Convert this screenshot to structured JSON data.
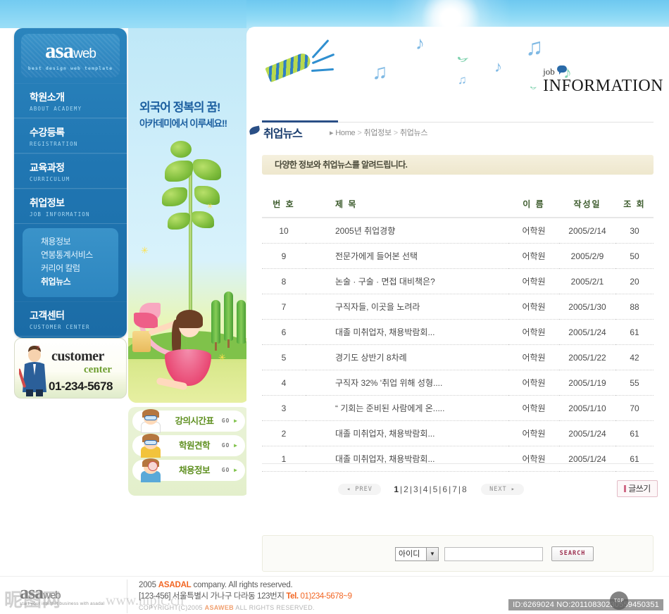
{
  "site": {
    "logo_main": "asa",
    "logo_web": "web",
    "logo_tagline": "best design web template"
  },
  "hero": {
    "line1": "외국어 정복의 꿈!",
    "line2": "아카데미에서 이루세요!!"
  },
  "sidebar": {
    "items": [
      {
        "ko": "학원소개",
        "en": "ABOUT ACADEMY"
      },
      {
        "ko": "수강등록",
        "en": "REGISTRATION"
      },
      {
        "ko": "교육과정",
        "en": "CURRICULUM"
      },
      {
        "ko": "취업정보",
        "en": "JOB INFORMATION"
      },
      {
        "ko": "고객센터",
        "en": "CUSTOMER CENTER"
      }
    ],
    "submenu": [
      {
        "label": "채용정보",
        "active": false
      },
      {
        "label": "연봉통계서비스",
        "active": false
      },
      {
        "label": "커리어 칼럼",
        "active": false
      },
      {
        "label": "취업뉴스",
        "active": true
      }
    ]
  },
  "customer_card": {
    "title": "customer",
    "subtitle": "center",
    "phone": "01-234-5678"
  },
  "quick_menu": [
    {
      "label": "강의시간표",
      "go": "GO"
    },
    {
      "label": "학원견학",
      "go": "GO"
    },
    {
      "label": "채용정보",
      "go": "GO"
    }
  ],
  "banner": {
    "job_small": "job",
    "job_big": "INFORMATION"
  },
  "page": {
    "title": "취업뉴스",
    "breadcrumb": {
      "home": "Home",
      "level1": "취업정보",
      "level2": "취업뉴스",
      "separator": ">"
    },
    "notice": "다양한 정보와 취업뉴스를 알려드립니다."
  },
  "table": {
    "headers": {
      "no": "번 호",
      "title": "제 목",
      "name": "이 름",
      "date": "작성일",
      "hits": "조 회"
    },
    "rows": [
      {
        "no": "10",
        "title": "2005년 취업경향",
        "name": "어학원",
        "date": "2005/2/14",
        "hits": "30"
      },
      {
        "no": "9",
        "title": "전문가에게 들어본 선택",
        "name": "어학원",
        "date": "2005/2/9",
        "hits": "50"
      },
      {
        "no": "8",
        "title": "논술 · 구술 · 면접 대비책은?",
        "name": "어학원",
        "date": "2005/2/1",
        "hits": "20"
      },
      {
        "no": "7",
        "title": "구직자들, 이곳을 노려라",
        "name": "어학원",
        "date": "2005/1/30",
        "hits": "88"
      },
      {
        "no": "6",
        "title": "대졸 미취업자, 채용박람회...",
        "name": "어학원",
        "date": "2005/1/24",
        "hits": "61"
      },
      {
        "no": "5",
        "title": "경기도 상반기 8차례",
        "name": "어학원",
        "date": "2005/1/22",
        "hits": "42"
      },
      {
        "no": "4",
        "title": "구직자 32% '취업 위해 성형....",
        "name": "어학원",
        "date": "2005/1/19",
        "hits": "55"
      },
      {
        "no": "3",
        "title": "“ 기회는 준비된 사람에게 온.....",
        "name": "어학원",
        "date": "2005/1/10",
        "hits": "70"
      },
      {
        "no": "2",
        "title": "대졸 미취업자, 채용박람회...",
        "name": "어학원",
        "date": "2005/1/24",
        "hits": "61"
      },
      {
        "no": "1",
        "title": "대졸 미취업자, 채용박람회...",
        "name": "어학원",
        "date": "2005/1/24",
        "hits": "61"
      }
    ]
  },
  "pagination": {
    "prev": "PREV",
    "next": "NEXT",
    "pages": [
      "1",
      "2",
      "3",
      "4",
      "5",
      "6",
      "7",
      "8"
    ],
    "current": "1",
    "separator": "|",
    "write_label": "글쓰기"
  },
  "search": {
    "select_value": "아이디",
    "input_value": "",
    "button_label": "SEARCH"
  },
  "footer": {
    "logo_main": "asa",
    "logo_web": "web",
    "logo_sub": "start your internet business with asadal",
    "line1_year": "2005",
    "line1_brand": "ASADAL",
    "line1_rest": "company.  All rights reserved.",
    "line2": "[123-456] 서울특별시 가나구 다라동 123번지",
    "line2_tel_label": "Tel.",
    "line2_tel": "01)234-5678~9",
    "line3_pre": "COPYRIGHT(C)2005",
    "line3_brand": "ASAWEB",
    "line3_post": "ALL RIGHTS RESERVED.",
    "id_text": "ID:6269024 NO:20110830230559450351",
    "top_label": "TOP"
  },
  "colors": {
    "sidebar_blue": "#2076b2",
    "accent_navy": "#2a4f86",
    "notice_bg": "#f1ecd9",
    "brand_orange": "#f26522",
    "quick_green": "#5e8f1f"
  }
}
